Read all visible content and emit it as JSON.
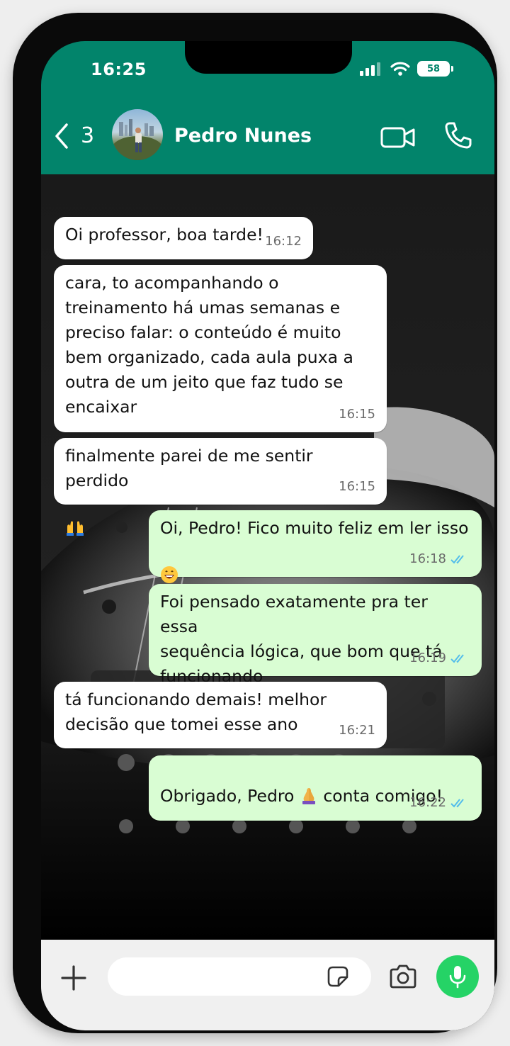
{
  "status_bar": {
    "time": "16:25",
    "battery": "58"
  },
  "header": {
    "unread_count": "3",
    "contact_name": "Pedro Nunes"
  },
  "messages": [
    {
      "direction": "in",
      "text": "Oi professor, boa tarde!",
      "time": "16:12"
    },
    {
      "direction": "in",
      "text": "cara, to acompanhando o\ntreinamento há umas semanas e\npreciso falar: o conteúdo é muito\nbem organizado, cada aula puxa a\noutra de um jeito que faz tudo se\nencaixar",
      "time": "16:15"
    },
    {
      "direction": "in",
      "text": "finalmente parei de me sentir perdido",
      "emoji": "🙌",
      "time": "16:15"
    },
    {
      "direction": "out",
      "text": "Oi, Pedro! Fico muito feliz em ler isso",
      "emoji": "😄",
      "time": "16:18",
      "read": true
    },
    {
      "direction": "out",
      "text": "Foi pensado exatamente pra ter essa\nsequência lógica, que bom que tá\nfuncionando",
      "time": "16:19",
      "read": true
    },
    {
      "direction": "in",
      "text": "tá funcionando demais! melhor\ndecisão que tomei esse ano",
      "time": "16:21"
    },
    {
      "direction": "out",
      "text_before": "Obrigado, Pedro",
      "emoji": "🙏",
      "text_after": "conta comigo!",
      "time": "16:22",
      "read": true
    }
  ],
  "colors": {
    "header": "#02846b",
    "outgoing_bubble": "#d9fdd3",
    "incoming_bubble": "#ffffff",
    "read_ticks": "#53bdeb",
    "mic_button": "#25d366"
  },
  "icons": [
    "back-chevron-icon",
    "video-call-icon",
    "phone-call-icon",
    "plus-icon",
    "sticker-icon",
    "camera-icon",
    "microphone-icon",
    "signal-icon",
    "wifi-icon",
    "battery-icon"
  ]
}
